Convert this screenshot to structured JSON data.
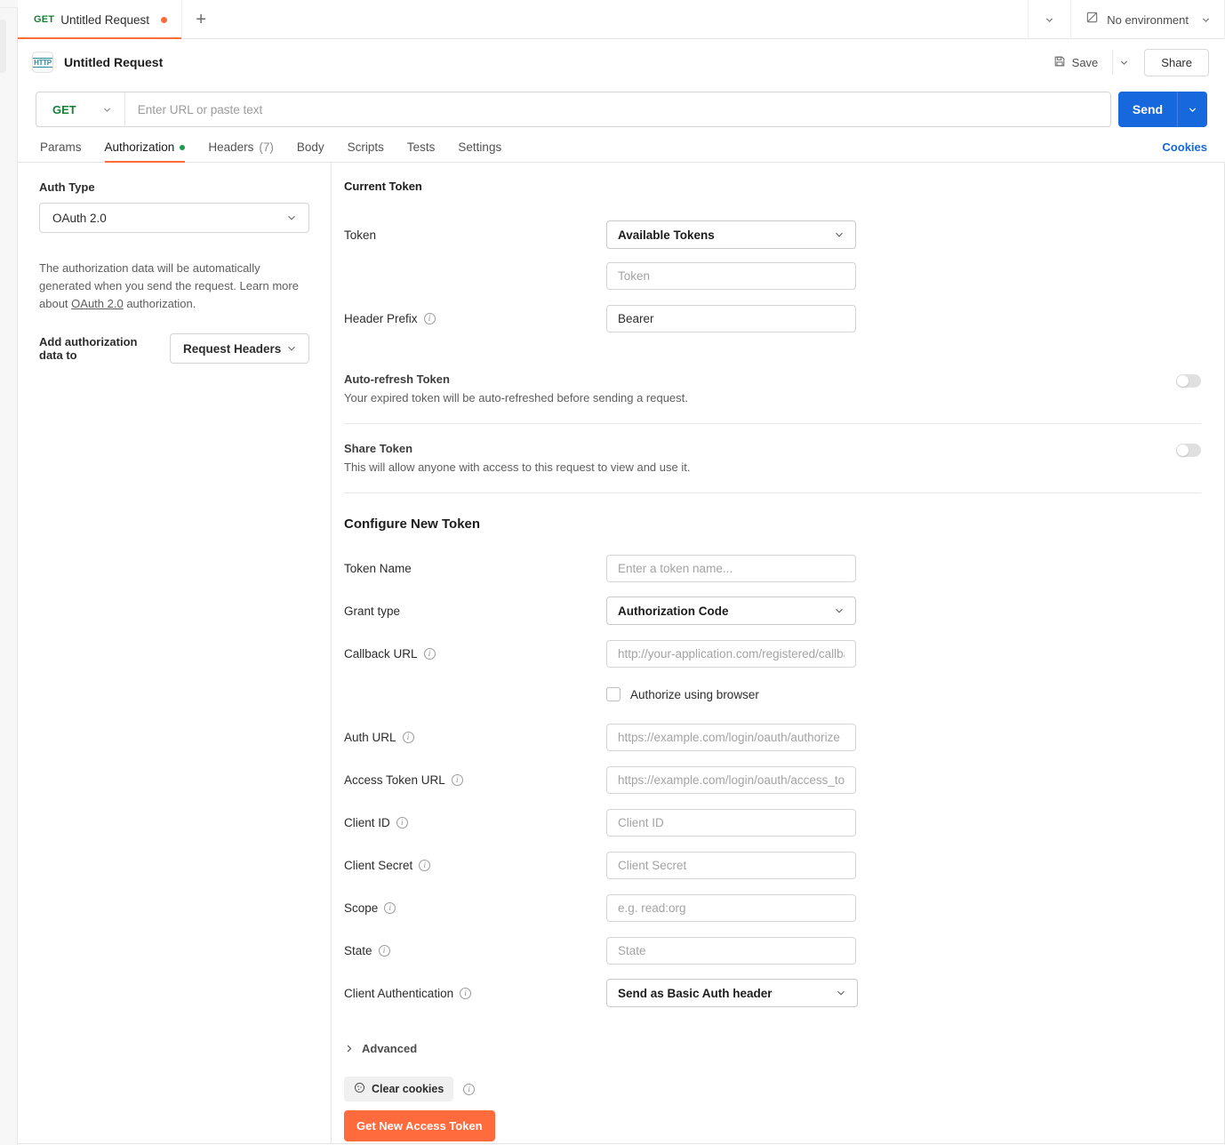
{
  "window": {
    "request_tab": {
      "method": "GET",
      "title": "Untitled Request",
      "unsaved_dot": "●"
    },
    "new_tab_label": "+",
    "environment": {
      "label": "No environment"
    }
  },
  "request_header": {
    "icon_text": "HTTP",
    "title": "Untitled Request",
    "save_label": "Save",
    "share_label": "Share"
  },
  "url_bar": {
    "method": "GET",
    "url_value": "",
    "url_placeholder": "Enter URL or paste text",
    "send_label": "Send"
  },
  "section_tabs": {
    "items": [
      {
        "label": "Params",
        "badge": "",
        "dot": false,
        "active": false
      },
      {
        "label": "Authorization",
        "badge": "",
        "dot": true,
        "active": true
      },
      {
        "label": "Headers",
        "badge": "(7)",
        "dot": false,
        "active": false
      },
      {
        "label": "Body",
        "badge": "",
        "dot": false,
        "active": false
      },
      {
        "label": "Scripts",
        "badge": "",
        "dot": false,
        "active": false
      },
      {
        "label": "Tests",
        "badge": "",
        "dot": false,
        "active": false
      },
      {
        "label": "Settings",
        "badge": "",
        "dot": false,
        "active": false
      }
    ],
    "cookies_label": "Cookies"
  },
  "auth_panel": {
    "auth_type_label": "Auth Type",
    "auth_type_value": "OAuth 2.0",
    "description_part1": "The authorization data will be automatically generated when you send the request. Learn more about ",
    "description_link": "OAuth 2.0",
    "description_part2": " authorization.",
    "add_auth_label": "Add authorization data to",
    "add_auth_value": "Request Headers"
  },
  "current_token": {
    "heading": "Current Token",
    "token_label": "Token",
    "token_select_value": "Available Tokens",
    "token_input_value": "",
    "token_input_placeholder": "Token",
    "header_prefix_label": "Header Prefix",
    "header_prefix_value": "Bearer",
    "auto_refresh": {
      "title": "Auto-refresh Token",
      "subtitle": "Your expired token will be auto-refreshed before sending a request.",
      "enabled": false
    },
    "share_token": {
      "title": "Share Token",
      "subtitle": "This will allow anyone with access to this request to view and use it.",
      "enabled": false
    }
  },
  "configure_new_token": {
    "heading": "Configure New Token",
    "token_name_label": "Token Name",
    "token_name_value": "",
    "token_name_placeholder": "Enter a token name...",
    "grant_type_label": "Grant type",
    "grant_type_value": "Authorization Code",
    "callback_url_label": "Callback URL",
    "callback_url_value": "",
    "callback_url_placeholder": "http://your-application.com/registered/callback",
    "authorize_browser_label": "Authorize using browser",
    "authorize_browser_checked": false,
    "auth_url_label": "Auth URL",
    "auth_url_value": "",
    "auth_url_placeholder": "https://example.com/login/oauth/authorize",
    "access_token_url_label": "Access Token URL",
    "access_token_url_value": "",
    "access_token_url_placeholder": "https://example.com/login/oauth/access_token",
    "client_id_label": "Client ID",
    "client_id_value": "",
    "client_id_placeholder": "Client ID",
    "client_secret_label": "Client Secret",
    "client_secret_value": "",
    "client_secret_placeholder": "Client Secret",
    "scope_label": "Scope",
    "scope_value": "",
    "scope_placeholder": "e.g. read:org",
    "state_label": "State",
    "state_value": "",
    "state_placeholder": "State",
    "client_auth_label": "Client Authentication",
    "client_auth_value": "Send as Basic Auth header",
    "advanced_label": "Advanced",
    "clear_cookies_label": "Clear cookies",
    "get_token_label": "Get New Access Token"
  },
  "colors": {
    "accent_orange": "#ff6c37",
    "send_blue": "#1668dc",
    "method_green": "#1a7f37",
    "token_button": "#ff6b3d",
    "border": "#e4e4e4"
  }
}
